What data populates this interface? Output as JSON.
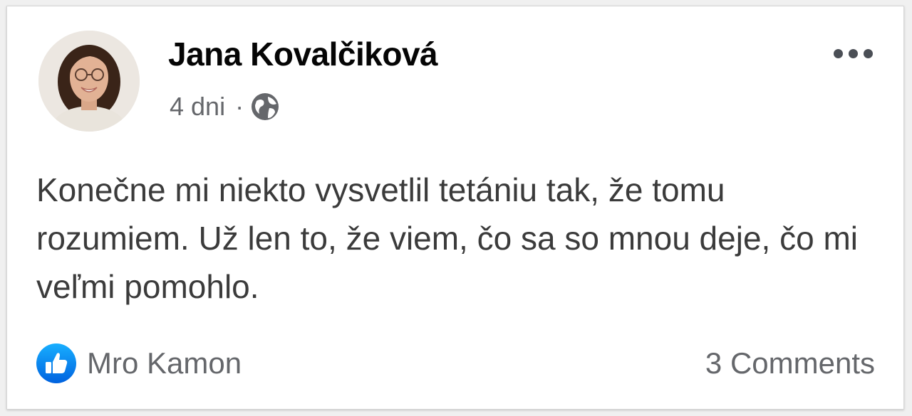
{
  "post": {
    "author_name": "Jana Kovalčiková",
    "timestamp": "4 dni",
    "separator": "·",
    "audience_icon": "globe-icon",
    "text": "Konečne mi niekto vysvetlil tetániu tak, že tomu rozumiem. Už len to, že viem, čo sa so mnou deje, čo mi veľmi pomohlo."
  },
  "footer": {
    "reaction_icon": "like-icon",
    "reactor_name": "Mro Kamon",
    "comments_label": "3 Comments"
  },
  "colors": {
    "author_text": "#050505",
    "secondary_text": "#65676b",
    "body_text": "#3b3b3b",
    "like_blue": "#1877f2",
    "card_background": "#ffffff"
  }
}
